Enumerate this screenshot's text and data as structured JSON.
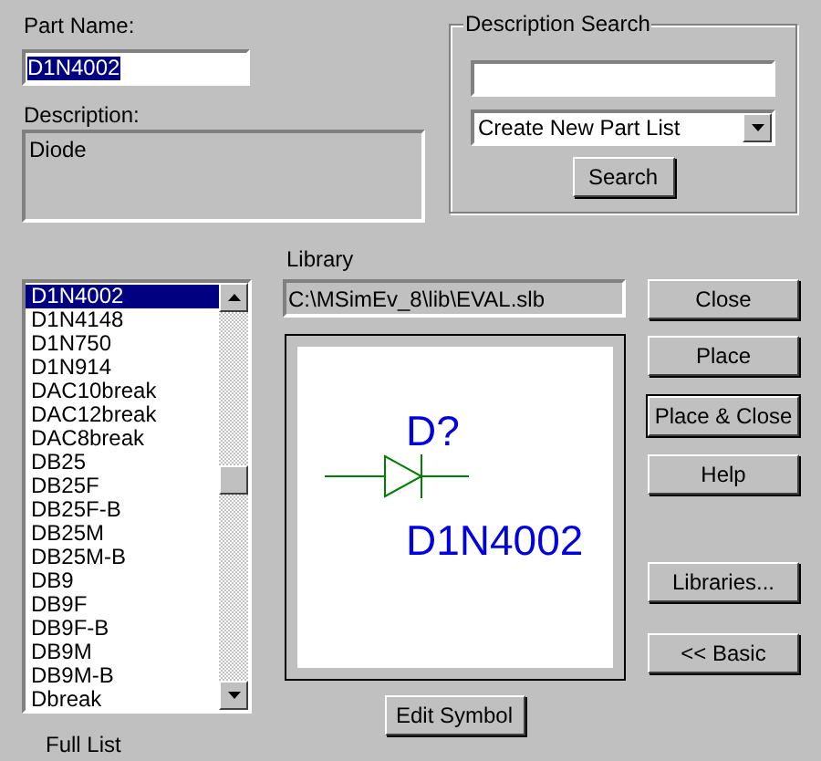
{
  "part_name": {
    "label": "Part Name:",
    "value": "D1N4002",
    "selected": true
  },
  "description": {
    "label": "Description:",
    "value": "Diode"
  },
  "description_search": {
    "title": "Description Search",
    "dropdown": "Create New Part List",
    "button": "Search"
  },
  "library": {
    "label": "Library",
    "path": "C:\\MSimEv_8\\lib\\EVAL.slb"
  },
  "parts_list": {
    "items": [
      {
        "label": "D1N4002",
        "selected": true
      },
      {
        "label": "D1N4148",
        "selected": false
      },
      {
        "label": "D1N750",
        "selected": false
      },
      {
        "label": "D1N914",
        "selected": false
      },
      {
        "label": "DAC10break",
        "selected": false
      },
      {
        "label": "DAC12break",
        "selected": false
      },
      {
        "label": "DAC8break",
        "selected": false
      },
      {
        "label": "DB25",
        "selected": false
      },
      {
        "label": "DB25F",
        "selected": false
      },
      {
        "label": "DB25F-B",
        "selected": false
      },
      {
        "label": "DB25M",
        "selected": false
      },
      {
        "label": "DB25M-B",
        "selected": false
      },
      {
        "label": "DB9",
        "selected": false
      },
      {
        "label": "DB9F",
        "selected": false
      },
      {
        "label": "DB9F-B",
        "selected": false
      },
      {
        "label": "DB9M",
        "selected": false
      },
      {
        "label": "DB9M-B",
        "selected": false
      },
      {
        "label": "Dbreak",
        "selected": false
      }
    ],
    "caption": "Full List"
  },
  "preview": {
    "reference": "D?",
    "part": "D1N4002"
  },
  "edit_button": "Edit Symbol",
  "buttons": [
    {
      "label": "Close",
      "default": false
    },
    {
      "label": "Place",
      "default": false
    },
    {
      "label": "Place & Close",
      "default": true
    },
    {
      "label": "Help",
      "default": false
    },
    {
      "label": "Libraries...",
      "default": false
    },
    {
      "label": "<< Basic",
      "default": false
    }
  ]
}
